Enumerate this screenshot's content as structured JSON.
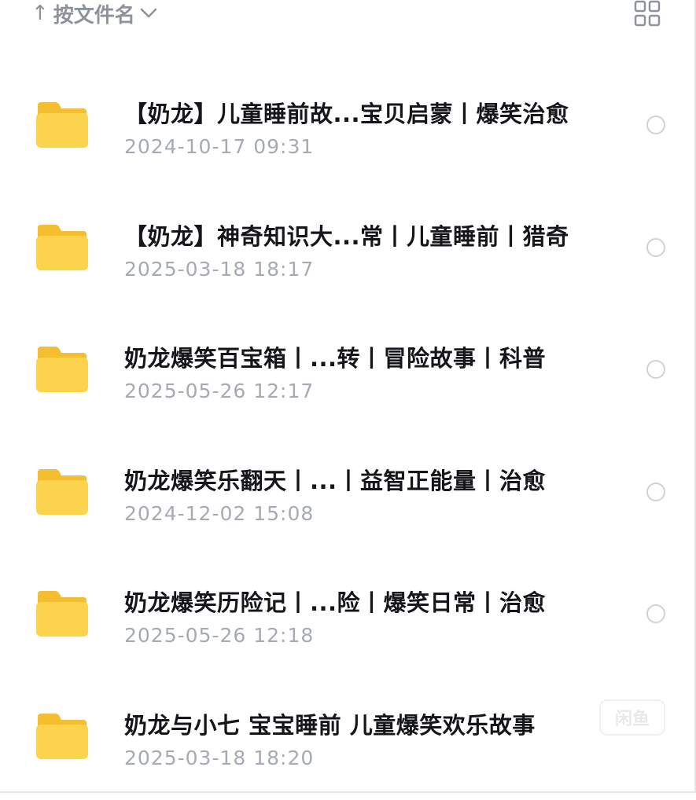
{
  "header": {
    "sort_label": "按文件名",
    "sort_arrow": "↑"
  },
  "files": [
    {
      "name": "【奶龙】儿童睡前故...宝贝启蒙丨爆笑治愈",
      "date": "2024-10-17 09:31"
    },
    {
      "name": "【奶龙】神奇知识大...常丨儿童睡前丨猎奇",
      "date": "2025-03-18 18:17"
    },
    {
      "name": "奶龙爆笑百宝箱丨...转丨冒险故事丨科普",
      "date": "2025-05-26 12:17"
    },
    {
      "name": "奶龙爆笑乐翻天丨...丨益智正能量丨治愈",
      "date": "2024-12-02 15:08"
    },
    {
      "name": "奶龙爆笑历险记丨...险丨爆笑日常丨治愈",
      "date": "2025-05-26 12:18"
    },
    {
      "name": "奶龙与小七  宝宝睡前  儿童爆笑欢乐故事",
      "date": "2025-03-18 18:20"
    }
  ],
  "watermark": "闲鱼",
  "colors": {
    "folder": "#fbd24a",
    "title": "#14161a",
    "date": "#a6aab2",
    "muted_icon": "#8e929a"
  }
}
